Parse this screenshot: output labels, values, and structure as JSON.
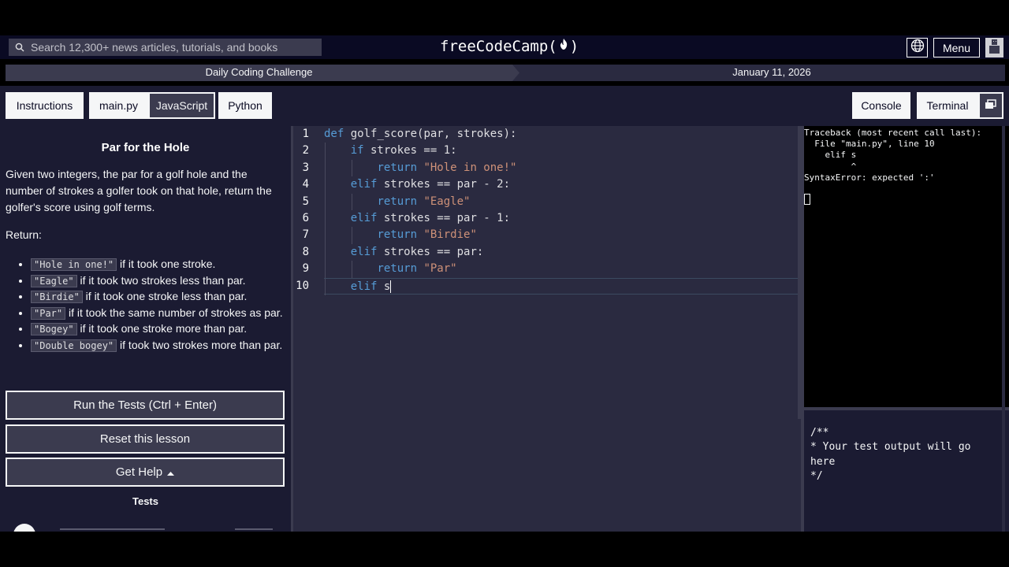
{
  "nav": {
    "search_placeholder": "Search 12,300+ news articles, tutorials, and books",
    "brand": "freeCodeCamp(",
    "brand_close": ")",
    "menu_label": "Menu"
  },
  "challenge": {
    "title": "Daily Coding Challenge",
    "date": "January 11, 2026"
  },
  "tabs": {
    "instructions": "Instructions",
    "main_file": "main.py",
    "javascript": "JavaScript",
    "python": "Python",
    "console": "Console",
    "terminal": "Terminal"
  },
  "instructions": {
    "title": "Par for the Hole",
    "description": "Given two integers, the par for a golf hole and the number of strokes a golfer took on that hole, return the golfer's score using golf terms.",
    "return_label": "Return:",
    "rules": [
      {
        "code": "\"Hole in one!\"",
        "text": " if it took one stroke."
      },
      {
        "code": "\"Eagle\"",
        "text": " if it took two strokes less than par."
      },
      {
        "code": "\"Birdie\"",
        "text": " if it took one stroke less than par."
      },
      {
        "code": "\"Par\"",
        "text": " if it took the same number of strokes as par."
      },
      {
        "code": "\"Bogey\"",
        "text": " if it took one stroke more than par."
      },
      {
        "code": "\"Double bogey\"",
        "text": " if took two strokes more than par."
      }
    ],
    "run_button": "Run the Tests (Ctrl + Enter)",
    "reset_button": "Reset this lesson",
    "help_button": "Get Help",
    "tests_label": "Tests"
  },
  "editor": {
    "line_numbers": [
      "1",
      "2",
      "3",
      "4",
      "5",
      "6",
      "7",
      "8",
      "9",
      "10"
    ],
    "lines": [
      {
        "indent": "",
        "kw": "def",
        "rest": " golf_score(par, strokes):",
        "str": ""
      },
      {
        "indent": "    ",
        "kw": "if",
        "rest": " strokes == 1:",
        "str": ""
      },
      {
        "indent": "        ",
        "kw": "return",
        "rest": " ",
        "str": "\"Hole in one!\""
      },
      {
        "indent": "    ",
        "kw": "elif",
        "rest": " strokes == par - 2:",
        "str": ""
      },
      {
        "indent": "        ",
        "kw": "return",
        "rest": " ",
        "str": "\"Eagle\""
      },
      {
        "indent": "    ",
        "kw": "elif",
        "rest": " strokes == par - 1:",
        "str": ""
      },
      {
        "indent": "        ",
        "kw": "return",
        "rest": " ",
        "str": "\"Birdie\""
      },
      {
        "indent": "    ",
        "kw": "elif",
        "rest": " strokes == par:",
        "str": ""
      },
      {
        "indent": "        ",
        "kw": "return",
        "rest": " ",
        "str": "\"Par\""
      },
      {
        "indent": "    ",
        "kw": "elif",
        "rest": " s",
        "str": ""
      }
    ]
  },
  "console": {
    "output": "Traceback (most recent call last):\n  File \"main.py\", line 10\n    elif s\n         ^\nSyntaxError: expected ':'"
  },
  "test_output": {
    "text": "/**\n* Your test output will go here\n*/"
  },
  "colors": {
    "keyword": "#569cd6",
    "string": "#ce9178",
    "nav_bg": "#0a0a23",
    "panel_bg": "#1b1b32",
    "editor_bg": "#2a2a40"
  },
  "icons": [
    "search-icon",
    "globe-icon",
    "flame-icon",
    "avatar-icon",
    "caret-up-icon",
    "layout-toggle-icon"
  ]
}
